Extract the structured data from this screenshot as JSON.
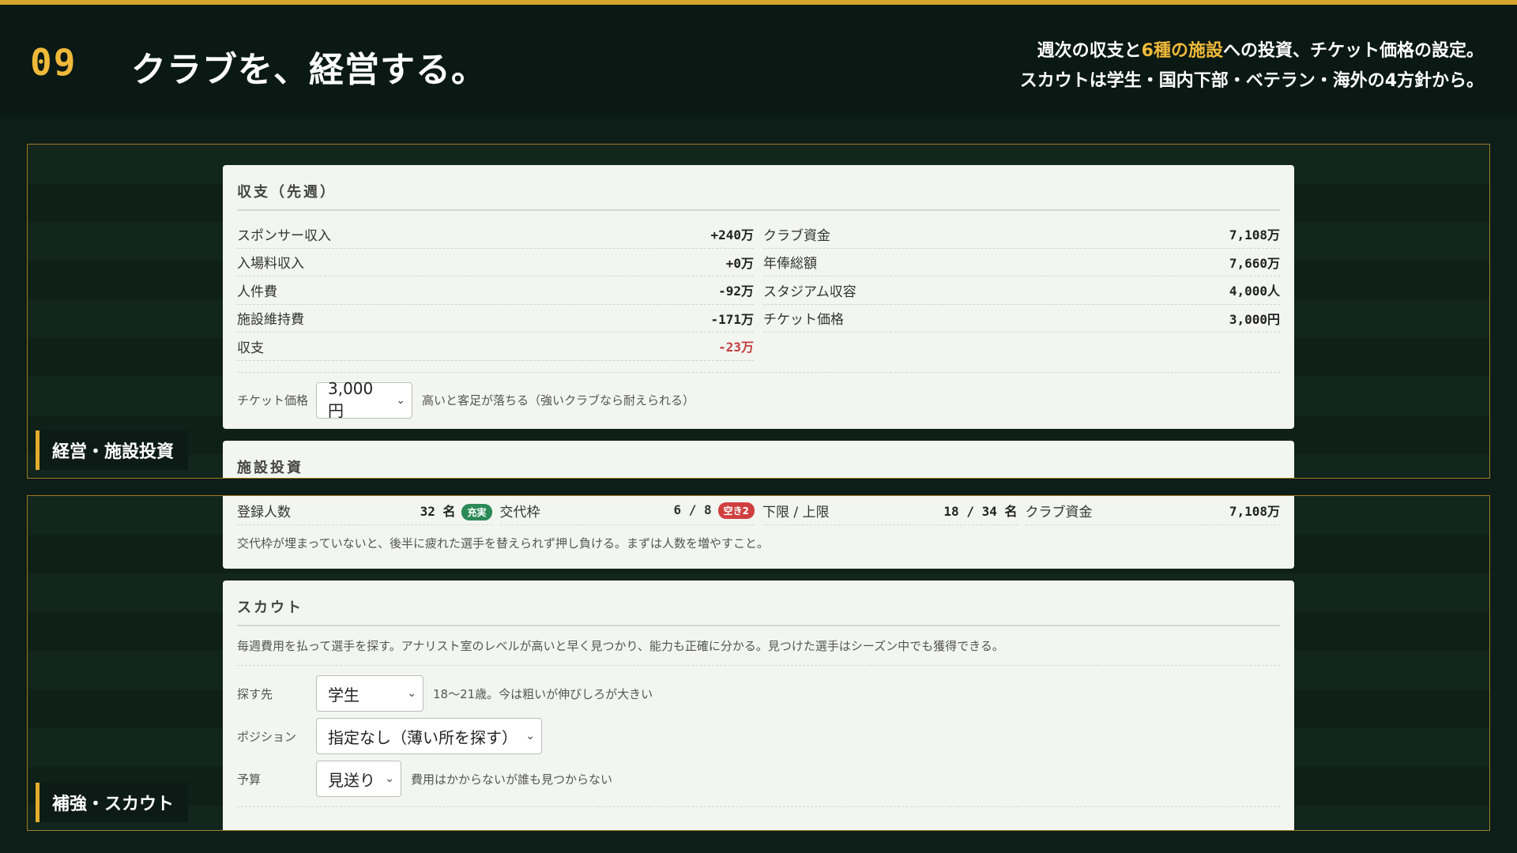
{
  "header": {
    "number": "09",
    "title": "クラブを、経営する。",
    "desc_line1_pre": "週次の収支と",
    "desc_line1_hl": "6種の施設",
    "desc_line1_post": "への投資、チケット価格の設定。",
    "desc_line2": "スカウトは学生・国内下部・ベテラン・海外の4方針から。"
  },
  "finance_panel": {
    "label": "経営・施設投資",
    "card_title": "収支（先週）",
    "left_rows": [
      {
        "label": "スポンサー収入",
        "value": "+240万"
      },
      {
        "label": "入場料収入",
        "value": "+0万"
      },
      {
        "label": "人件費",
        "value": "-92万"
      },
      {
        "label": "施設維持費",
        "value": "-171万"
      },
      {
        "label": "収支",
        "value": "-23万"
      }
    ],
    "right_rows": [
      {
        "label": "クラブ資金",
        "value": "7,108万"
      },
      {
        "label": "年俸総額",
        "value": "7,660万"
      },
      {
        "label": "スタジアム収容",
        "value": "4,000人"
      },
      {
        "label": "チケット価格",
        "value": "3,000円"
      }
    ],
    "ticket_label": "チケット価格",
    "ticket_select": "3,000円",
    "ticket_hint": "高いと客足が落ちる（強いクラブなら耐えられる）",
    "facility_title": "施設投資"
  },
  "squad_panel": {
    "label": "補強・スカウト",
    "stats": [
      {
        "label": "登録人数",
        "value": "32 名",
        "badge": "充実",
        "badge_color": "#2b8a57"
      },
      {
        "label": "交代枠",
        "value": "6 / 8",
        "badge": "空き2",
        "badge_color": "#cf3f3f"
      },
      {
        "label": "下限 / 上限",
        "value": "18 / 34 名"
      },
      {
        "label": "クラブ資金",
        "value": "7,108万"
      }
    ],
    "note": "交代枠が埋まっていないと、後半に疲れた選手を替えられず押し負ける。まずは人数を増やすこと。",
    "scout_title": "スカウト",
    "scout_desc": "毎週費用を払って選手を探す。アナリスト室のレベルが高いと早く見つかり、能力も正確に分かる。見つけた選手はシーズン中でも獲得できる。",
    "target_label": "探す先",
    "target_select": "学生",
    "target_hint": "18〜21歳。今は粗いが伸びしろが大きい",
    "position_label": "ポジション",
    "position_select": "指定なし（薄い所を探す）",
    "budget_label": "予算",
    "budget_select": "見送り",
    "budget_hint": "費用はかからないが誰も見つからない"
  }
}
